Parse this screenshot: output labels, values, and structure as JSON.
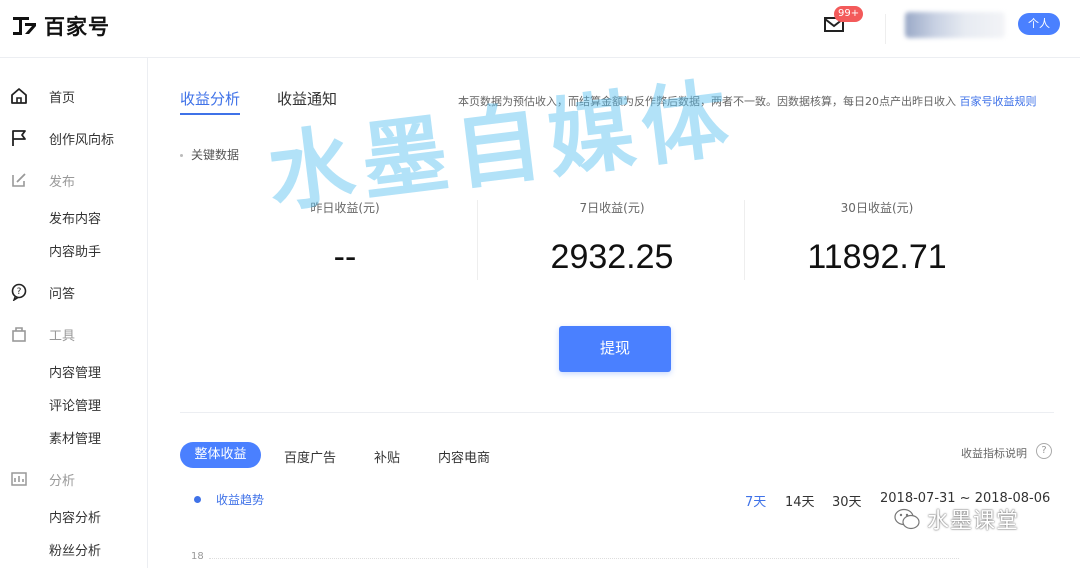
{
  "header": {
    "logo_text": "百家号",
    "mail_badge": "99+",
    "role_badge": "个人"
  },
  "sidebar": {
    "items": [
      {
        "label": "首页",
        "icon": "home-icon"
      },
      {
        "label": "创作风向标",
        "icon": "flag-icon"
      },
      {
        "label": "发布",
        "icon": "edit-icon"
      },
      {
        "label": "发布内容"
      },
      {
        "label": "内容助手"
      },
      {
        "label": "问答",
        "icon": "question-icon"
      },
      {
        "label": "工具",
        "icon": "bag-icon"
      },
      {
        "label": "内容管理"
      },
      {
        "label": "评论管理"
      },
      {
        "label": "素材管理"
      },
      {
        "label": "分析",
        "icon": "chart-icon"
      },
      {
        "label": "内容分析"
      },
      {
        "label": "粉丝分析"
      }
    ]
  },
  "main": {
    "tabs": [
      {
        "label": "收益分析",
        "active": true
      },
      {
        "label": "收益通知",
        "active": false
      }
    ],
    "notice": "本页数据为预估收入，而结算金额为反作弊后数据，两者不一致。因数据核算，每日20点产出昨日收入",
    "notice_link": "百家号收益规则",
    "key_title": "关键数据",
    "stats": [
      {
        "label": "昨日收益(元)",
        "value": "--"
      },
      {
        "label": "7日收益(元)",
        "value": "2932.25"
      },
      {
        "label": "30日收益(元)",
        "value": "11892.71"
      }
    ],
    "withdraw_label": "提现",
    "subtabs": [
      {
        "label": "整体收益",
        "active": true
      },
      {
        "label": "百度广告",
        "active": false
      },
      {
        "label": "补贴",
        "active": false
      },
      {
        "label": "内容电商",
        "active": false
      }
    ],
    "help_text": "收益指标说明",
    "help_icon": "?",
    "trend_label": "收益趋势",
    "ranges": [
      {
        "label": "7天",
        "active": true
      },
      {
        "label": "14天",
        "active": false
      },
      {
        "label": "30天",
        "active": false
      }
    ],
    "date_range": "2018-07-31 ~ 2018-08-06",
    "y_tick": "18"
  },
  "watermark": {
    "big": "水墨自媒体",
    "small": "水墨课堂"
  },
  "colors": {
    "accent": "#4a80ff",
    "link": "#3f72e8",
    "badge": "#f35a5a",
    "watermark": "#54bef0"
  }
}
